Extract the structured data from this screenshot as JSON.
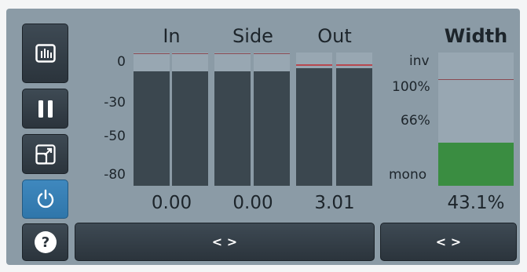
{
  "headers": {
    "in": "In",
    "side": "Side",
    "out": "Out",
    "width": "Width"
  },
  "scale": {
    "s0": "0",
    "s30": "-30",
    "s50": "-50",
    "s80": "-80"
  },
  "values": {
    "in": "0.00",
    "side": "0.00",
    "out": "3.01",
    "width": "43.1%"
  },
  "width_labels": {
    "inv": "inv",
    "p100": "100%",
    "p66": "66%",
    "mono": "mono"
  },
  "width_level": 0.326,
  "meters": {
    "in": {
      "left_level": 0.86,
      "right_level": 0.86
    },
    "side": {
      "left_level": 0.86,
      "right_level": 0.86
    },
    "out": {
      "left_level": 0.88,
      "right_level": 0.88
    }
  },
  "buttons": {
    "bottom_left": "< >",
    "bottom_right": "< >"
  },
  "icons": [
    "meter-view-icon",
    "pause-icon",
    "resize-icon",
    "power-icon",
    "help-icon"
  ],
  "colors": {
    "panel": "#8b9ba6",
    "meter_fill": "#3b474f",
    "width_fill": "#3a8d41",
    "power_active": "#3f88be",
    "peak": "#b7484f"
  }
}
